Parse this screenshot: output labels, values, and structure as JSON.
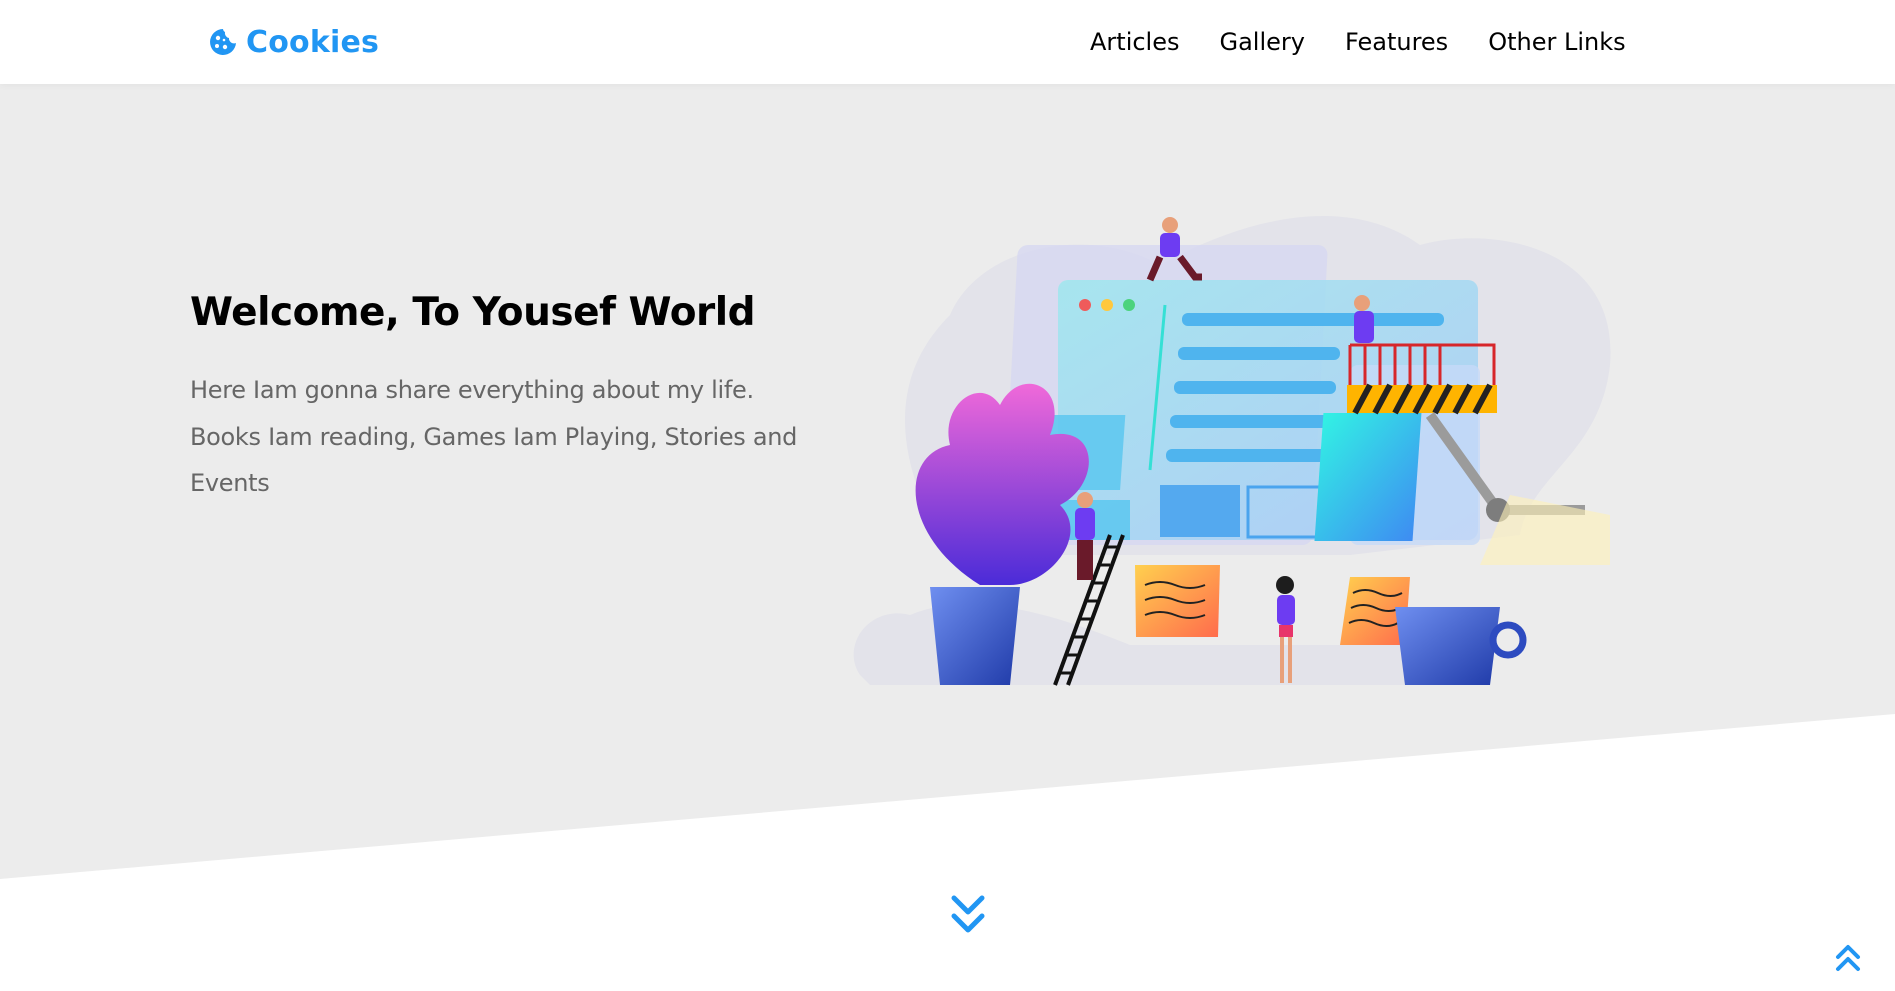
{
  "brand": {
    "name": "Cookies",
    "icon": "cookie-icon",
    "color": "#2196f3"
  },
  "nav": {
    "items": [
      "Articles",
      "Gallery",
      "Features",
      "Other Links"
    ]
  },
  "hero": {
    "title": "Welcome, To Yousef World",
    "description": "Here Iam gonna share everything about my life. Books Iam reading, Games Iam Playing, Stories and Events",
    "background": "#ececec"
  },
  "controls": {
    "scroll_down_icon": "double-chevron-down-icon",
    "back_to_top_icon": "double-chevron-up-icon"
  },
  "colors": {
    "accent": "#2196f3",
    "text": "#000000",
    "muted": "#666666"
  }
}
